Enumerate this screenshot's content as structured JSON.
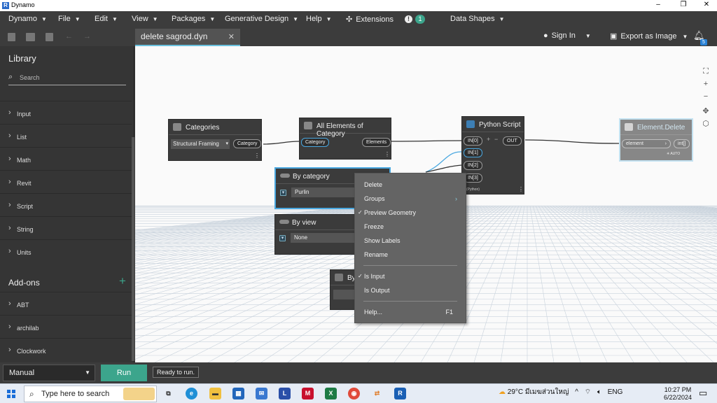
{
  "window": {
    "title": "Dynamo",
    "logo": "R",
    "controls": [
      "–",
      "❐",
      "✕"
    ]
  },
  "menubar": {
    "items": [
      {
        "label": "Dynamo"
      },
      {
        "label": "File"
      },
      {
        "label": "Edit"
      },
      {
        "label": "View"
      },
      {
        "label": "Packages"
      },
      {
        "label": "Generative Design"
      },
      {
        "label": "Help"
      }
    ],
    "extensions": "Extensions",
    "notification_count": "1",
    "data_shapes": "Data Shapes"
  },
  "toolbar": {
    "tab_title": "delete sagrod.dyn",
    "tab_close": "✕",
    "sign_in": "Sign In",
    "export": "Export as Image",
    "bell_badge": "5"
  },
  "sidebar": {
    "title": "Library",
    "search_placeholder": "Search",
    "items": [
      {
        "label": "Input"
      },
      {
        "label": "List"
      },
      {
        "label": "Math"
      },
      {
        "label": "Revit"
      },
      {
        "label": "Script"
      },
      {
        "label": "String"
      },
      {
        "label": "Units"
      }
    ],
    "addons_title": "Add-ons",
    "addons": [
      {
        "label": "ABT"
      },
      {
        "label": "archilab"
      },
      {
        "label": "Clockwork"
      }
    ]
  },
  "nodes": {
    "categories": {
      "title": "Categories",
      "value": "Structural Framing",
      "out": "Category"
    },
    "all_elements": {
      "title": "All Elements of Category",
      "in": "Category",
      "out": "Elements"
    },
    "python": {
      "title": "Python Script",
      "inputs": [
        "IN[0]",
        "IN[1]",
        "IN[2]",
        "IN[3]"
      ],
      "out": "OUT",
      "footer": "(Python)"
    },
    "element_delete": {
      "title": "Element.Delete",
      "in": "element",
      "out": "int[]",
      "lacing": "AUTO"
    },
    "by_category": {
      "title": "By category",
      "value": "Purlin"
    },
    "by_view": {
      "title": "By view",
      "value": "None"
    },
    "string_node": {
      "title": "By"
    }
  },
  "context_menu": {
    "items": [
      {
        "label": "Delete",
        "check": "",
        "shortcut": ""
      },
      {
        "label": "Groups",
        "check": "",
        "shortcut": "›"
      },
      {
        "label": "Preview Geometry",
        "check": "✓",
        "shortcut": ""
      },
      {
        "label": "Freeze",
        "check": "",
        "shortcut": ""
      },
      {
        "label": "Show Labels",
        "check": "",
        "shortcut": ""
      },
      {
        "label": "Rename",
        "check": "",
        "shortcut": ""
      },
      {
        "label": "Is Input",
        "check": "✓",
        "shortcut": ""
      },
      {
        "label": "Is Output",
        "check": "",
        "shortcut": ""
      },
      {
        "label": "Help...",
        "check": "",
        "shortcut": "F1"
      }
    ]
  },
  "bottom": {
    "run_mode": "Manual",
    "run": "Run",
    "status": "Ready to run."
  },
  "taskbar": {
    "search_placeholder": "Type here to search",
    "weather": "29°C",
    "weather_desc": "มีเมฆส่วนใหญ่",
    "language": "ENG",
    "time": "10:27 PM",
    "date": "6/22/2024"
  },
  "colors": {
    "accent": "#3ca58c",
    "selection": "#6ac2df",
    "wire": "#333333",
    "wire_selected": "#4aa8e0"
  }
}
